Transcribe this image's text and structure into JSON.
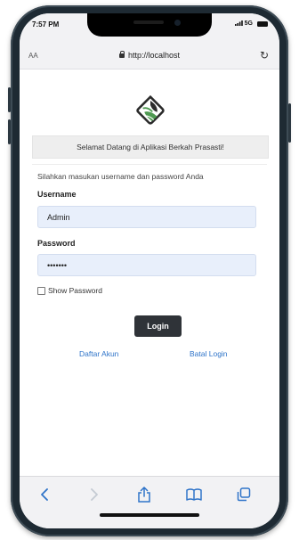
{
  "status_bar": {
    "time": "7:57 PM",
    "network": "5G"
  },
  "browser": {
    "text_size_label": "AA",
    "url": "http://localhost"
  },
  "page": {
    "welcome_text": "Selamat Datang di Aplikasi Berkah Prasasti!",
    "instructions": "Silahkan masukan username dan password Anda",
    "username_label": "Username",
    "username_value": "Admin",
    "password_label": "Password",
    "password_value": "•••••••",
    "show_password_label": "Show Password",
    "login_button": "Login",
    "register_link": "Daftar Akun",
    "cancel_link": "Batal Login"
  },
  "toolbar": {
    "icons": [
      "back-icon",
      "forward-icon",
      "share-icon",
      "bookmarks-icon",
      "tabs-icon"
    ]
  },
  "colors": {
    "logo_dark": "#2b2b2b",
    "logo_green": "#4f9a52",
    "link": "#2f74c9",
    "ios_blue": "#2f74c9",
    "field_bg": "#e8effb",
    "button_bg": "#2f3338"
  }
}
